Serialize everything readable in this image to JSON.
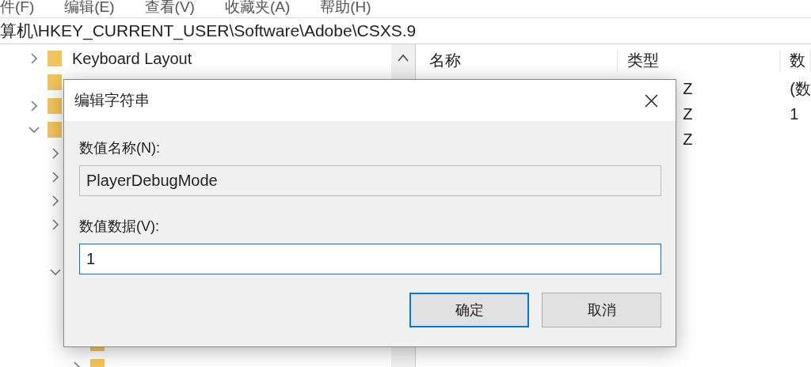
{
  "menu_bar": [
    "件(F)",
    "编辑(E)",
    "查看(V)",
    "收藏夹(A)",
    "帮助(H)"
  ],
  "address_bar": {
    "path": "算机\\HKEY_CURRENT_USER\\Software\\Adobe\\CSXS.9"
  },
  "tree": [
    {
      "label": "Keyboard Layout",
      "kind": "branch",
      "expanded": false
    },
    {
      "kind": "leaf"
    },
    {
      "kind": "branch",
      "expanded": false
    },
    {
      "kind": "branch",
      "expanded": true,
      "children": [
        {
          "kind": "branch",
          "expanded": false
        },
        {
          "kind": "branch",
          "expanded": false
        },
        {
          "kind": "branch",
          "expanded": false
        },
        {
          "kind": "branch",
          "expanded": false
        },
        {
          "kind": "leaf"
        },
        {
          "kind": "branch",
          "expanded": true,
          "children": [
            {
              "kind": "leaf"
            },
            {
              "kind": "leaf"
            },
            {
              "kind": "leaf"
            },
            {
              "kind": "branch",
              "expanded": false
            }
          ]
        }
      ]
    }
  ],
  "values": {
    "columns": [
      "名称",
      "类型",
      "数"
    ],
    "rows": [
      {
        "type": "Z",
        "data": "(数"
      },
      {
        "type": "Z",
        "data": "1"
      },
      {
        "type": "Z"
      }
    ]
  },
  "dialog": {
    "title": "编辑字符串",
    "name_label": "数值名称(N):",
    "name_value": "PlayerDebugMode",
    "data_label": "数值数据(V):",
    "data_value": "1",
    "buttons": [
      {
        "label": "确定",
        "default": true
      },
      {
        "label": "取消",
        "default": false
      }
    ]
  }
}
